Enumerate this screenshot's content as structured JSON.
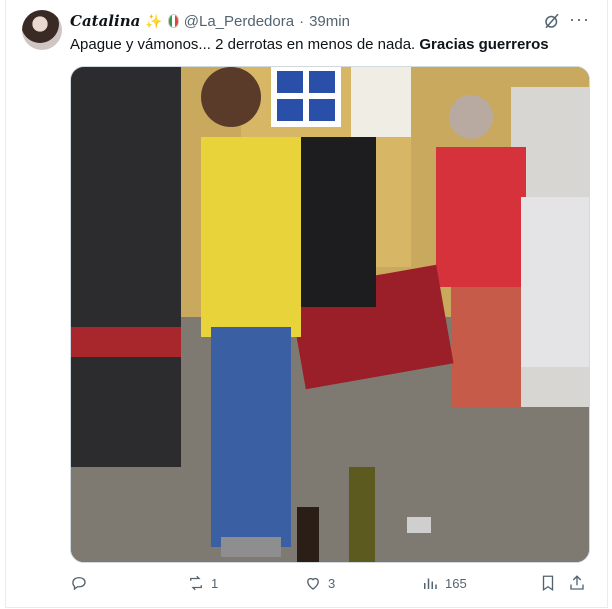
{
  "tweet": {
    "display_name": "Catalina",
    "emoji": "✨",
    "handle": "@La_Perdedora",
    "separator": "·",
    "time": "39min",
    "text_normal": "Apague y vámonos... 2 derrotas  en menos de nada. ",
    "text_bold": "Gracias guerreros",
    "more_label": "···"
  },
  "actions": {
    "replies": "",
    "retweets": "1",
    "likes": "3",
    "views": "165"
  },
  "icons": {
    "reply": "reply-icon",
    "retweet": "retweet-icon",
    "like": "heart-icon",
    "views": "views-icon",
    "bookmark": "bookmark-icon",
    "share": "share-icon",
    "grok": "grok-icon",
    "more": "more-icon"
  },
  "colors": {
    "muted": "#536471",
    "text": "#0f1419",
    "border": "#cfd9de"
  }
}
